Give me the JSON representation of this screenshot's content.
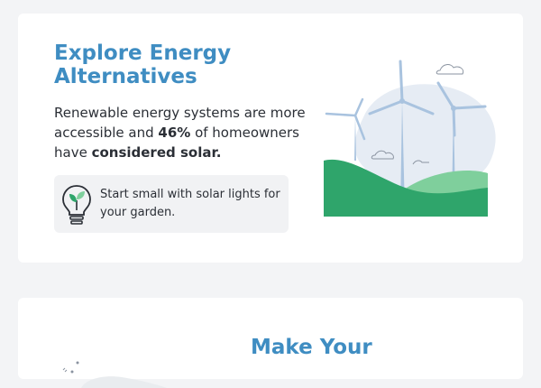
{
  "section_1": {
    "title": "Explore Energy Alternatives",
    "body_before": "Renewable energy systems are more accessible and ",
    "body_stat": "46%",
    "body_middle": " of homeowners have ",
    "body_emphasis": "considered solar.",
    "tip": {
      "icon": "lightbulb-sprout-icon",
      "text": "Start small with solar lights for your garden."
    },
    "illustration": "wind-turbines-illustration"
  },
  "section_2": {
    "title": "Make Your",
    "illustration": "globe-illustration"
  },
  "colors": {
    "background": "#f3f4f6",
    "card": "#ffffff",
    "heading": "#3f8dc2",
    "body_text": "#2b2f36",
    "tip_background": "#f1f2f4",
    "hill_dark": "#2fa56b",
    "hill_light": "#7fcf9c",
    "turbine": "#a9c3df",
    "sky_blob": "#e6ecf4"
  }
}
